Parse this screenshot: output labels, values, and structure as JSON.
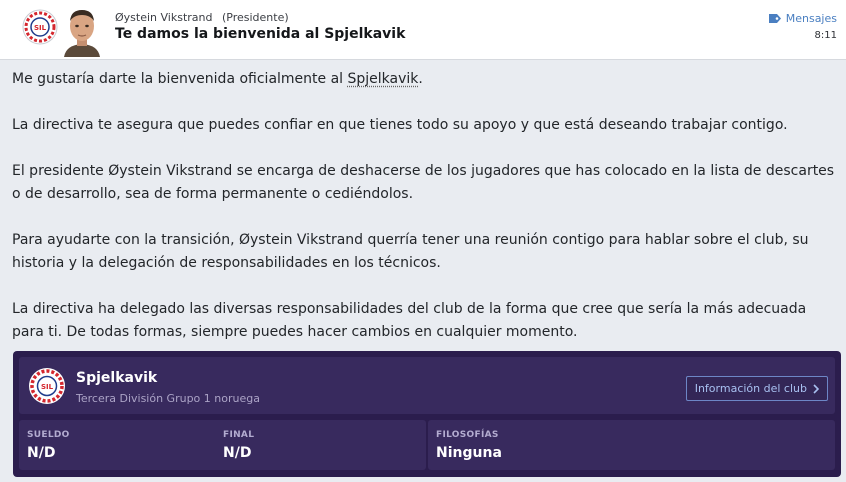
{
  "header": {
    "sender_name": "Øystein Vikstrand",
    "sender_role": "(Presidente)",
    "subject": "Te damos la bienvenida al Spjelkavik",
    "folder_label": "Mensajes",
    "time": "8:11"
  },
  "message": {
    "p1_prefix": "Me gustaría darte la bienvenida oficialmente al ",
    "p1_link": "Spjelkavik",
    "p1_suffix": ".",
    "p2": "La directiva te asegura que puedes confiar en que tienes todo su apoyo y que está deseando trabajar contigo.",
    "p3": "El presidente Øystein Vikstrand se encarga de deshacerse de los jugadores que has colocado en la lista de descartes o de desarrollo, sea de forma permanente o cediéndolos.",
    "p4": "Para ayudarte con la transición, Øystein Vikstrand querría tener una reunión contigo para hablar sobre el club, su historia y la delegación de responsabilidades en los técnicos.",
    "p5": "La directiva ha delegado las diversas responsabilidades del club de la forma que cree que sería la más adecuada para ti. De todas formas, siempre puedes hacer cambios en cualquier momento."
  },
  "club_card": {
    "club_name": "Spjelkavik",
    "league": "Tercera División Grupo 1 noruega",
    "info_button": "Información del club",
    "crest_text": "SIL",
    "stats": [
      {
        "label": "SUELDO",
        "value": "N/D"
      },
      {
        "label": "FINAL",
        "value": "N/D"
      },
      {
        "label": "FILOSOFÍAS",
        "value": "Ninguna"
      }
    ]
  },
  "colors": {
    "card_background": "#2b1d4d",
    "card_panel": "#382a5e",
    "link_blue": "#4a7fc1",
    "crest_red": "#d4272e"
  },
  "icons": {
    "folder": "tag-icon",
    "button_arrow": "chevron-right-icon"
  }
}
